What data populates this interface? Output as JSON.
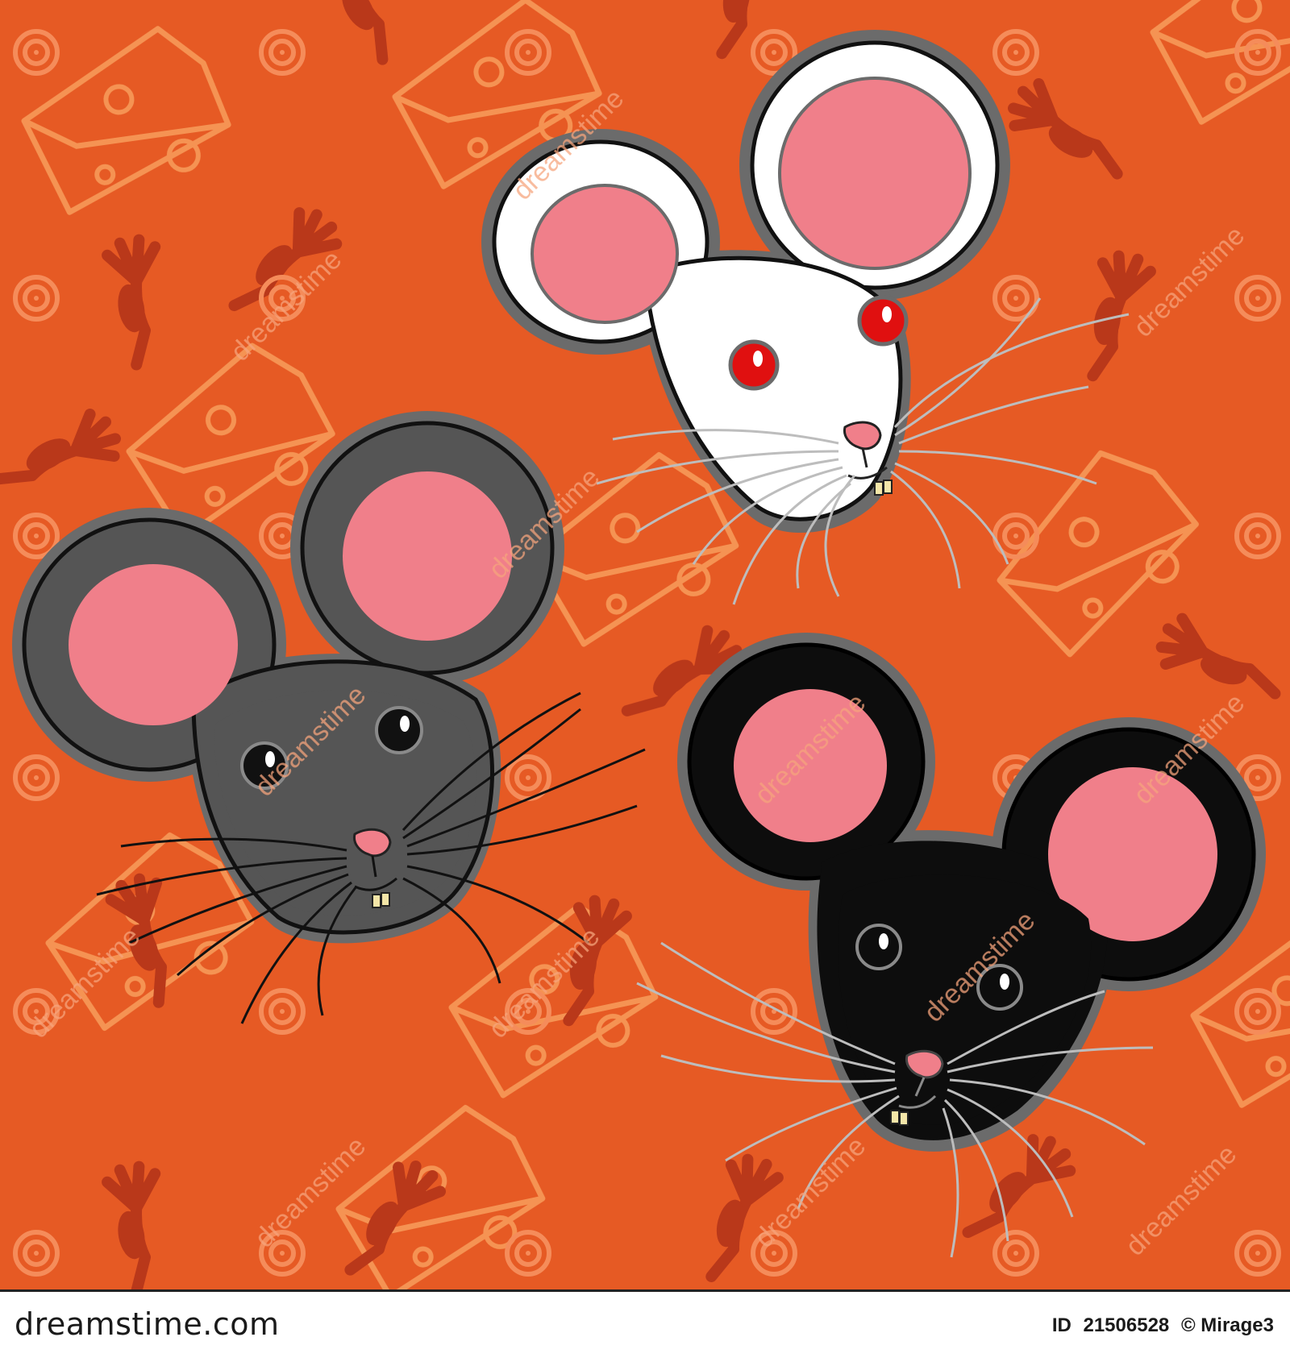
{
  "image": {
    "description_colors": {
      "background": "#e65a24",
      "print_color": "#b9381a",
      "cheese_outline": "#f79a5a",
      "spiral": "#f58c5a",
      "white_mouse": "#ffffff",
      "grey_mouse": "#5a5a5a",
      "black_mouse": "#0d0d0d",
      "ear_pink": "#f07f8a",
      "outline_grey": "#6b6b6b",
      "red_eye": "#e01010"
    },
    "watermark_text": "dreamstime"
  },
  "footer": {
    "brand": "dreamstime.com",
    "id_label": "ID",
    "id_value": "21506528",
    "copyright": "© Mirage3"
  }
}
